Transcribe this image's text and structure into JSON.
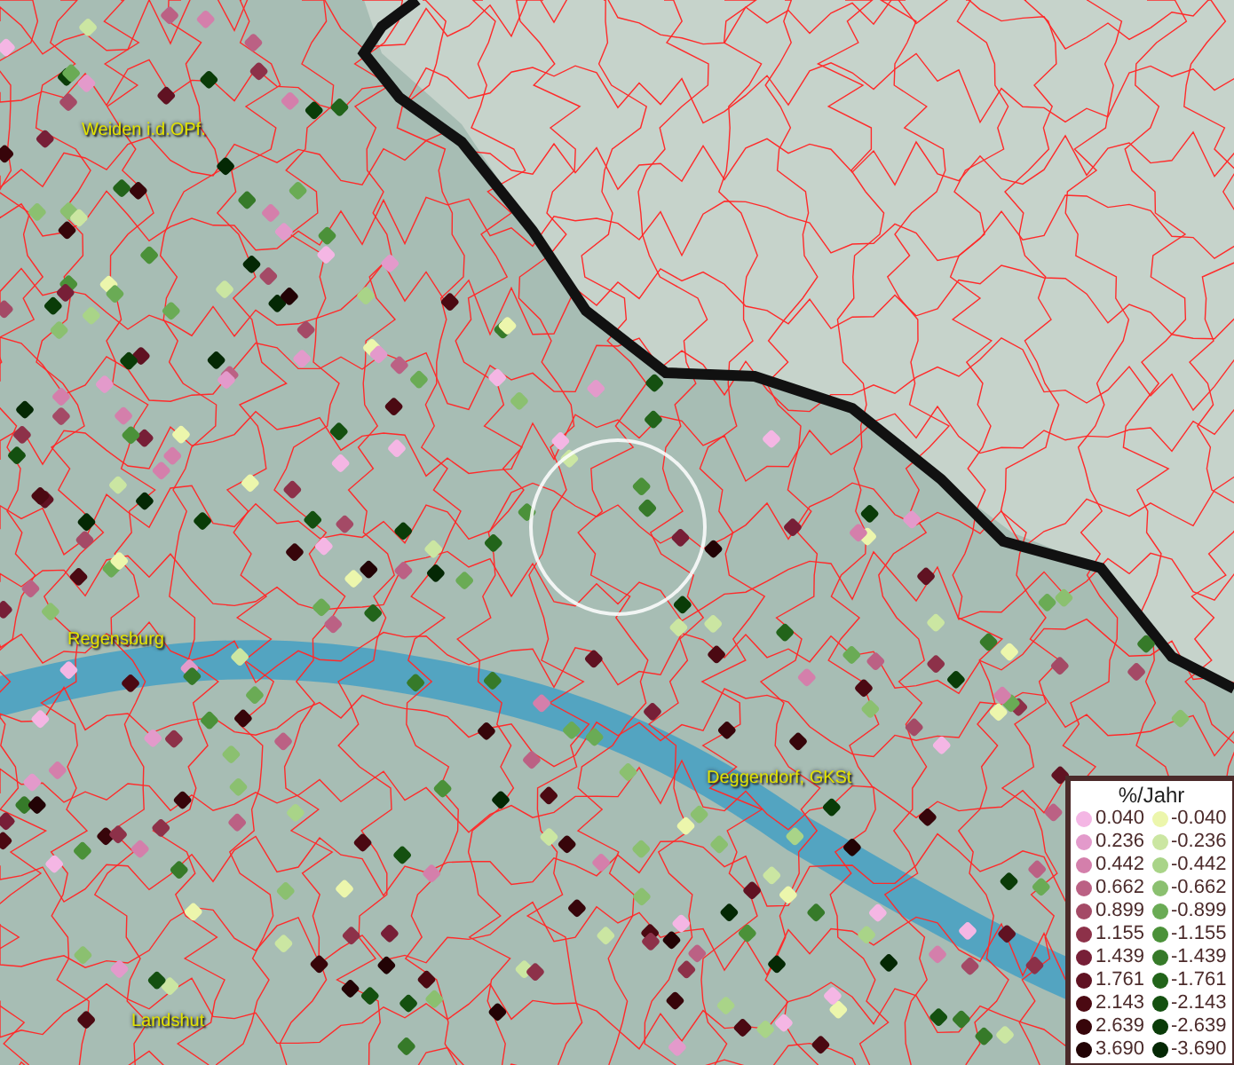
{
  "map": {
    "places": [
      {
        "name": "Weiden i.d.OPf."
      },
      {
        "name": "Regensburg"
      },
      {
        "name": "Deggendorf, GKSt"
      },
      {
        "name": "Landshut"
      }
    ]
  },
  "legend": {
    "title": "%/Jahr",
    "entries": [
      {
        "label": "0.040",
        "color": "#f4b6e4"
      },
      {
        "label": "-0.040",
        "color": "#ecf6ac"
      },
      {
        "label": "0.236",
        "color": "#e39acb"
      },
      {
        "label": "-0.236",
        "color": "#cbe6a2"
      },
      {
        "label": "0.442",
        "color": "#d47fab"
      },
      {
        "label": "-0.442",
        "color": "#a9d488"
      },
      {
        "label": "0.662",
        "color": "#bb6184"
      },
      {
        "label": "-0.662",
        "color": "#8bc070"
      },
      {
        "label": "0.899",
        "color": "#a44a66"
      },
      {
        "label": "-0.899",
        "color": "#6aab55"
      },
      {
        "label": "1.155",
        "color": "#8d3149"
      },
      {
        "label": "-1.155",
        "color": "#4b9139"
      },
      {
        "label": "1.439",
        "color": "#771f37"
      },
      {
        "label": "-1.439",
        "color": "#367a29"
      },
      {
        "label": "1.761",
        "color": "#601222"
      },
      {
        "label": "-1.761",
        "color": "#22641a"
      },
      {
        "label": "2.143",
        "color": "#4b0912"
      },
      {
        "label": "-2.143",
        "color": "#145010"
      },
      {
        "label": "2.639",
        "color": "#37050a"
      },
      {
        "label": "-2.639",
        "color": "#0a3c08"
      },
      {
        "label": "3.690",
        "color": "#220305"
      },
      {
        "label": "-3.690",
        "color": "#042804"
      }
    ]
  }
}
